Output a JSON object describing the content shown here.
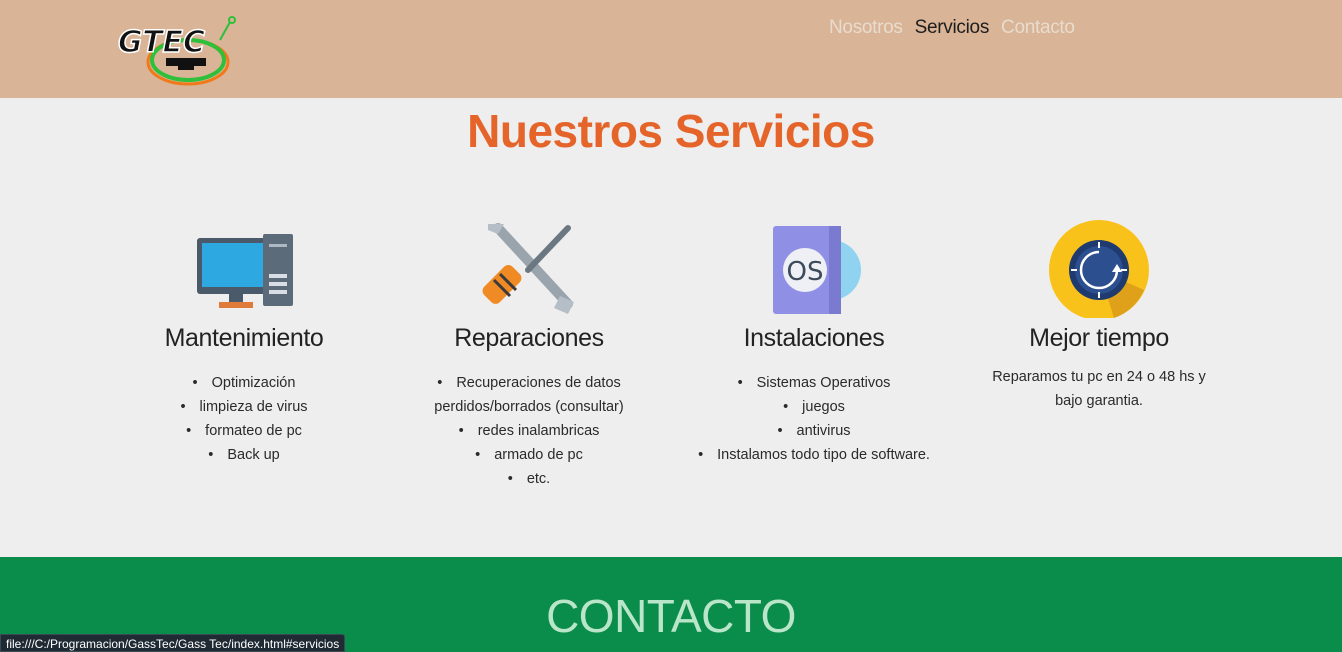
{
  "header": {
    "logo_text": "GTEC",
    "nav": [
      {
        "label": "Nosotros",
        "active": false
      },
      {
        "label": "Servicios",
        "active": true
      },
      {
        "label": "Contacto",
        "active": false
      }
    ]
  },
  "services": {
    "title": "Nuestros Servicios",
    "cards": [
      {
        "icon": "desktop-computer-icon",
        "title": "Mantenimiento",
        "items": [
          "Optimización",
          "limpieza de virus",
          "formateo de pc",
          "Back up"
        ]
      },
      {
        "icon": "tools-icon",
        "title": "Reparaciones",
        "items": [
          "Recuperaciones de datos perdidos/borrados (consultar)",
          "redes inalambricas",
          "armado de pc",
          "etc."
        ]
      },
      {
        "icon": "os-disk-icon",
        "title": "Instalaciones",
        "icon_text": "OS",
        "items": [
          "Sistemas Operativos",
          "juegos",
          "antivirus",
          "Instalamos todo tipo de software."
        ]
      },
      {
        "icon": "clock-timer-icon",
        "title": "Mejor tiempo",
        "text": "Reparamos tu pc en 24 o 48 hs y bajo garantia."
      }
    ]
  },
  "contact": {
    "title": "CONTACTO"
  },
  "status_bar": {
    "url": "file:///C:/Programacion/GassTec/Gass Tec/index.html#servicios"
  },
  "colors": {
    "header_bg": "#d9b497",
    "title_accent": "#e5642a",
    "contact_bg": "#0a8c4b",
    "nav_inactive": "#e8dccf"
  }
}
